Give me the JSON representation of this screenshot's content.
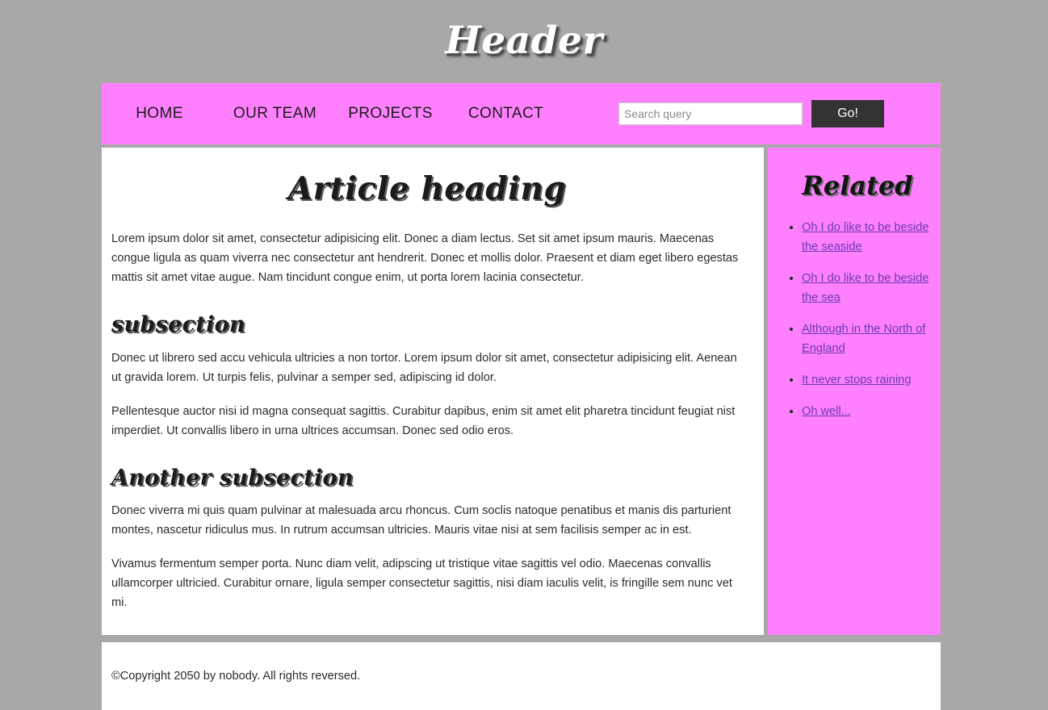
{
  "site": {
    "title": "Header",
    "background_color": "#a8a8a8",
    "accent_color": "#ff80ff",
    "button_color": "#333333",
    "link_color": "#6a3ab0"
  },
  "nav": {
    "items": [
      {
        "label": "HOME"
      },
      {
        "label": "OUR TEAM"
      },
      {
        "label": "PROJECTS"
      },
      {
        "label": "CONTACT"
      }
    ],
    "search": {
      "placeholder": "Search query",
      "value": "",
      "button_label": "Go!"
    }
  },
  "article": {
    "heading": "Article heading",
    "intro": "Lorem ipsum dolor sit amet, consectetur adipisicing elit. Donec a diam lectus. Set sit amet ipsum mauris. Maecenas congue ligula as quam viverra nec consectetur ant hendrerit. Donec et mollis dolor. Praesent et diam eget libero egestas mattis sit amet vitae augue. Nam tincidunt congue enim, ut porta lorem lacinia consectetur.",
    "sections": [
      {
        "heading": "subsection",
        "paragraphs": [
          "Donec ut librero sed accu vehicula ultricies a non tortor. Lorem ipsum dolor sit amet, consectetur adipisicing elit. Aenean ut gravida lorem. Ut turpis felis, pulvinar a semper sed, adipiscing id dolor.",
          "Pellentesque auctor nisi id magna consequat sagittis. Curabitur dapibus, enim sit amet elit pharetra tincidunt feugiat nist imperdiet. Ut convallis libero in urna ultrices accumsan. Donec sed odio eros."
        ]
      },
      {
        "heading": "Another subsection",
        "paragraphs": [
          "Donec viverra mi quis quam pulvinar at malesuada arcu rhoncus. Cum soclis natoque penatibus et manis dis parturient montes, nascetur ridiculus mus. In rutrum accumsan ultricies. Mauris vitae nisi at sem facilisis semper ac in est.",
          "Vivamus fermentum semper porta. Nunc diam velit, adipscing ut tristique vitae sagittis vel odio. Maecenas convallis ullamcorper ultricied. Curabitur ornare, ligula semper consectetur sagittis, nisi diam iaculis velit, is fringille sem nunc vet mi."
        ]
      }
    ]
  },
  "sidebar": {
    "heading": "Related",
    "links": [
      {
        "label": "Oh I do like to be beside the seaside"
      },
      {
        "label": "Oh I do like to be beside the sea"
      },
      {
        "label": "Although in the North of England"
      },
      {
        "label": "It never stops raining"
      },
      {
        "label": "Oh well..."
      }
    ]
  },
  "footer": {
    "copyright": "©Copyright 2050 by nobody. All rights reversed."
  }
}
